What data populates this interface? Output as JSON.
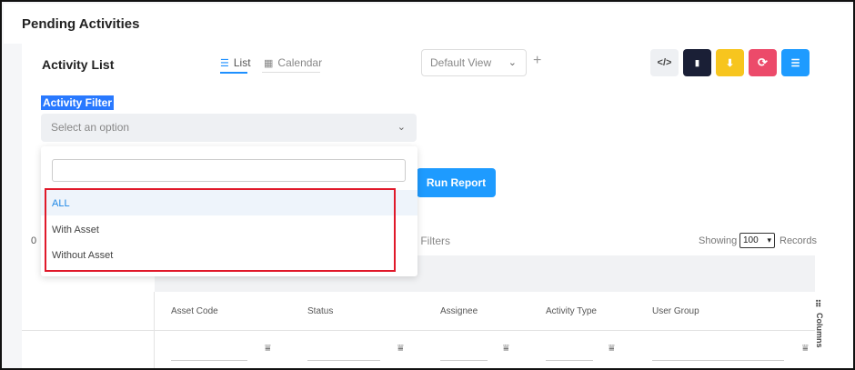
{
  "header": {
    "title": "Pending Activities"
  },
  "card": {
    "title": "Activity List",
    "tabs": [
      {
        "label": "List",
        "icon": "list-icon",
        "active": true
      },
      {
        "label": "Calendar",
        "icon": "calendar-icon",
        "active": false
      }
    ],
    "view_select": {
      "value": "Default View"
    },
    "add_view": "+",
    "toolbar": [
      {
        "name": "code-icon",
        "glyph": "</>",
        "color": "#eef0f3"
      },
      {
        "name": "document-icon",
        "glyph": "▮",
        "color": "#1a1f36"
      },
      {
        "name": "download-icon",
        "glyph": "⬇",
        "color": "#f7c51e"
      },
      {
        "name": "refresh-icon",
        "glyph": "⟳",
        "color": "#ec4a6a"
      },
      {
        "name": "settings-sliders-icon",
        "glyph": "☰",
        "color": "#1e9bff"
      }
    ]
  },
  "filter": {
    "label": "Activity Filter",
    "placeholder": "Select an option",
    "search_value": "",
    "options": [
      {
        "label": "ALL",
        "selected": true
      },
      {
        "label": "With Asset",
        "selected": false
      },
      {
        "label": "Without Asset",
        "selected": false
      }
    ]
  },
  "run_report": "Run Report",
  "partial": {
    "left_count": "0",
    "filters_text": "r Filters"
  },
  "pagination": {
    "showing": "Showing",
    "page_size": "100",
    "records": "Records"
  },
  "table": {
    "columns": [
      "Asset Code",
      "Status",
      "Assignee",
      "Activity Type",
      "User Group"
    ],
    "columns_toggle": "Columns"
  },
  "colors": {
    "accent": "#1e9bff",
    "highlight": "#2979ff",
    "outline": "#e0192a"
  }
}
